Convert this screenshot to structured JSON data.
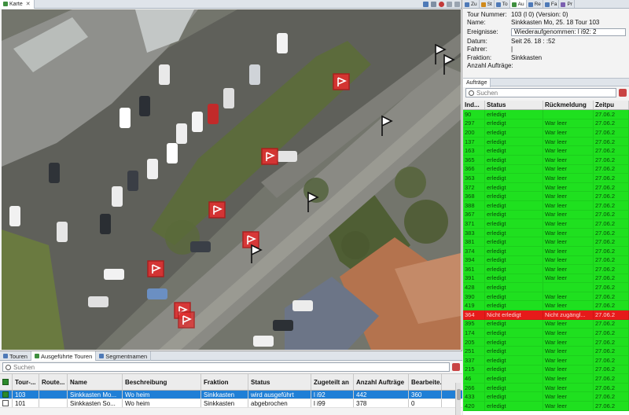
{
  "map_panel": {
    "tab_label": "Karte",
    "close_symbol": "✕"
  },
  "map": {
    "marker_colors": {
      "red": "#e03030",
      "red_border": "#b01a1a",
      "white": "#ffffff",
      "black": "#111111"
    }
  },
  "right_tabs": [
    {
      "label": "Zu",
      "icon": "tour-icon"
    },
    {
      "label": "St",
      "icon": "status-icon"
    },
    {
      "label": "To",
      "icon": "tour-icon"
    },
    {
      "label": "Au",
      "icon": "order-icon"
    },
    {
      "label": "Re",
      "icon": "report-icon"
    },
    {
      "label": "Fa",
      "icon": "vehicle-icon"
    },
    {
      "label": "Pr",
      "icon": "properties-icon"
    }
  ],
  "tour_details": {
    "tour_number_label": "Tour Nummer:",
    "tour_number_value": "103 (l                    0) (Version: 0)",
    "name_label": "Name:",
    "name_value": "Sinkkasten Mo, 25.        18 Tour 103",
    "events_label": "Ereignisse:",
    "events_value": "Wiederaufgenommen: l              i92: 2",
    "date_label": "Datum:",
    "date_value": "Seit 26.        18 :          :52",
    "driver_label": "Fahrer:",
    "driver_value": "|",
    "fraction_label": "Fraktion:",
    "fraction_value": "Sinkkasten",
    "order_count_label": "Anzahl Aufträge:",
    "order_count_value": ""
  },
  "orders_panel": {
    "tab_label": "Aufträge",
    "search_placeholder": "Suchen",
    "columns": [
      "Ind...",
      "Status",
      "Rückmeldung",
      "Zeitpu"
    ],
    "rows": [
      {
        "ind": "90",
        "status": "erledigt",
        "rm": "",
        "zeit": "27.06.2"
      },
      {
        "ind": "297",
        "status": "erledigt",
        "rm": "War leer",
        "zeit": "27.06.2"
      },
      {
        "ind": "200",
        "status": "erledigt",
        "rm": "War leer",
        "zeit": "27.06.2"
      },
      {
        "ind": "137",
        "status": "erledigt",
        "rm": "War leer",
        "zeit": "27.06.2"
      },
      {
        "ind": "163",
        "status": "erledigt",
        "rm": "War leer",
        "zeit": "27.06.2"
      },
      {
        "ind": "365",
        "status": "erledigt",
        "rm": "War leer",
        "zeit": "27.06.2"
      },
      {
        "ind": "366",
        "status": "erledigt",
        "rm": "War leer",
        "zeit": "27.06.2"
      },
      {
        "ind": "363",
        "status": "erledigt",
        "rm": "War leer",
        "zeit": "27.06.2"
      },
      {
        "ind": "372",
        "status": "erledigt",
        "rm": "War leer",
        "zeit": "27.06.2"
      },
      {
        "ind": "368",
        "status": "erledigt",
        "rm": "War leer",
        "zeit": "27.06.2"
      },
      {
        "ind": "388",
        "status": "erledigt",
        "rm": "War leer",
        "zeit": "27.06.2"
      },
      {
        "ind": "367",
        "status": "erledigt",
        "rm": "War leer",
        "zeit": "27.06.2"
      },
      {
        "ind": "371",
        "status": "erledigt",
        "rm": "War leer",
        "zeit": "27.06.2"
      },
      {
        "ind": "383",
        "status": "erledigt",
        "rm": "War leer",
        "zeit": "27.06.2"
      },
      {
        "ind": "381",
        "status": "erledigt",
        "rm": "War leer",
        "zeit": "27.06.2"
      },
      {
        "ind": "374",
        "status": "erledigt",
        "rm": "War leer",
        "zeit": "27.06.2"
      },
      {
        "ind": "394",
        "status": "erledigt",
        "rm": "War leer",
        "zeit": "27.06.2"
      },
      {
        "ind": "361",
        "status": "erledigt",
        "rm": "War leer",
        "zeit": "27.06.2"
      },
      {
        "ind": "391",
        "status": "erledigt",
        "rm": "War leer",
        "zeit": "27.06.2"
      },
      {
        "ind": "428",
        "status": "erledigt",
        "rm": "",
        "zeit": "27.06.2"
      },
      {
        "ind": "390",
        "status": "erledigt",
        "rm": "War leer",
        "zeit": "27.06.2"
      },
      {
        "ind": "419",
        "status": "erledigt",
        "rm": "War leer",
        "zeit": "27.06.2"
      },
      {
        "ind": "364",
        "status": "Nicht erledigt",
        "rm": "Nicht zugängl...",
        "zeit": "27.06.2",
        "state": "notdone"
      },
      {
        "ind": "395",
        "status": "erledigt",
        "rm": "War leer",
        "zeit": "27.06.2"
      },
      {
        "ind": "174",
        "status": "erledigt",
        "rm": "War leer",
        "zeit": "27.06.2"
      },
      {
        "ind": "205",
        "status": "erledigt",
        "rm": "War leer",
        "zeit": "27.06.2"
      },
      {
        "ind": "251",
        "status": "erledigt",
        "rm": "War leer",
        "zeit": "27.06.2"
      },
      {
        "ind": "337",
        "status": "erledigt",
        "rm": "War leer",
        "zeit": "27.06.2"
      },
      {
        "ind": "215",
        "status": "erledigt",
        "rm": "War leer",
        "zeit": "27.06.2"
      },
      {
        "ind": "46",
        "status": "erledigt",
        "rm": "War leer",
        "zeit": "27.06.2"
      },
      {
        "ind": "266",
        "status": "erledigt",
        "rm": "War leer",
        "zeit": "27.06.2"
      },
      {
        "ind": "433",
        "status": "erledigt",
        "rm": "War leer",
        "zeit": "27.06.2"
      },
      {
        "ind": "420",
        "status": "erledigt",
        "rm": "War leer",
        "zeit": "27.06.2"
      }
    ]
  },
  "bottom_tabs": [
    {
      "label": "Touren",
      "icon": "tours-icon"
    },
    {
      "label": "Ausgeführte Touren",
      "icon": "executed-tours-icon",
      "active": true
    },
    {
      "label": "Segmentnamen",
      "icon": "segment-icon"
    }
  ],
  "tours_panel": {
    "search_placeholder": "Suchen",
    "columns": [
      "Tour-...",
      "Route...",
      "Name",
      "Beschreibung",
      "Fraktion",
      "Status",
      "Zugeteilt an",
      "Anzahl Aufträge",
      "Bearbeite..."
    ],
    "rows": [
      {
        "checked": true,
        "tour": "103",
        "route": "",
        "name": "Sinkkasten Mo...",
        "desc": "Wo            heim",
        "fraktion": "Sinkkasten",
        "status": "wird ausgeführt",
        "zug": "l          i92",
        "anz": "442",
        "bear": "360",
        "selected": true
      },
      {
        "checked": false,
        "tour": "101",
        "route": "",
        "name": "Sinkkasten So...",
        "desc": "Wo            heim",
        "fraktion": "Sinkkasten",
        "status": "abgebrochen",
        "zug": "l          i99",
        "anz": "378",
        "bear": "0"
      }
    ]
  }
}
